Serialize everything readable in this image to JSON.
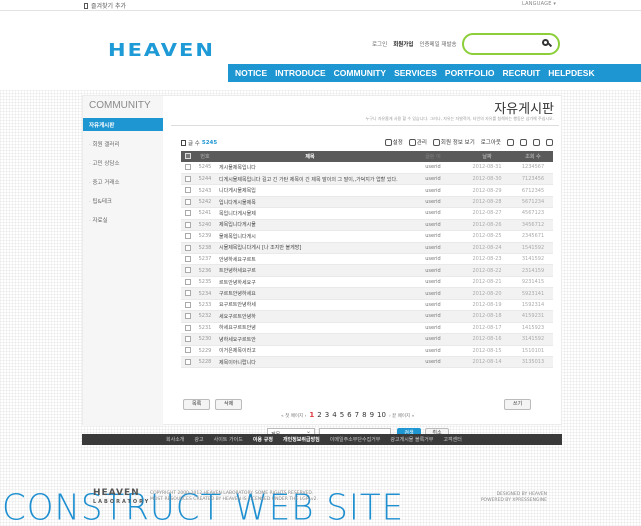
{
  "topbar": {
    "favorite": "즐겨찾기 추가",
    "language": "LANGUAGE ▾"
  },
  "header": {
    "logo": "HEAVEN",
    "member_links": [
      "로그인",
      "회원가입",
      "인증메일 재발송"
    ],
    "nav": [
      "NOTICE",
      "INTRODUCE",
      "COMMUNITY",
      "SERVICES",
      "PORTFOLIO",
      "RECRUIT",
      "HELPDESK"
    ]
  },
  "sidebar": {
    "title": "COMMUNITY",
    "active": "자유게시판",
    "items": [
      "회원 갤러리",
      "고민 상담소",
      "중고 거래소",
      "팁&테크",
      "자료실"
    ]
  },
  "board": {
    "title": "자유게시판",
    "description": "누구나 자유롭게 사용 할 수 있습니다. 그러나, 자유는 자발적이, 타인의 자유를 침해하는 행동은 삼가해 주십시오.",
    "count_label": "글 수",
    "count": "5245",
    "tools": [
      "설정",
      "관리",
      "회원 정보 보기",
      "로그아웃"
    ],
    "columns": [
      "번호",
      "제목",
      "글쓴 이",
      "날짜",
      "조회 수"
    ],
    "rows": [
      {
        "no": "5245",
        "title": "게시물제목입니다",
        "user": "userid",
        "date": "2012-08-31",
        "hits": "1234567"
      },
      {
        "no": "5244",
        "title": "디게시물제목입니다 길고 긴 가탄 제목이 긴 제목 말이의 그 말이,,가덕지가 업할 있다.",
        "user": "userid",
        "date": "2012-08-30",
        "hits": "7123456"
      },
      {
        "no": "5243",
        "title": "니다게시물제목입",
        "user": "userid",
        "date": "2012-08-29",
        "hits": "6712345"
      },
      {
        "no": "5242",
        "title": "입니다게시물제목",
        "user": "userid",
        "date": "2012-08-28",
        "hits": "5671234"
      },
      {
        "no": "5241",
        "title": "목입니다게시물제",
        "user": "userid",
        "date": "2012-08-27",
        "hits": "4567123"
      },
      {
        "no": "5240",
        "title": "제목입니다게시물",
        "user": "userid",
        "date": "2012-08-26",
        "hits": "3456712"
      },
      {
        "no": "5239",
        "title": "물제목입니다게시",
        "user": "userid",
        "date": "2012-08-25",
        "hits": "2345671"
      },
      {
        "no": "5238",
        "title": "시물제목입니다게시 [나 조지만 볼게방]",
        "user": "userid",
        "date": "2012-08-24",
        "hits": "1541592"
      },
      {
        "no": "5237",
        "title": "안녕하세요구르트",
        "user": "userid",
        "date": "2012-08-23",
        "hits": "3141592"
      },
      {
        "no": "5236",
        "title": "트안녕하세요구르",
        "user": "userid",
        "date": "2012-08-22",
        "hits": "2314159"
      },
      {
        "no": "5235",
        "title": "르트안녕하세요구",
        "user": "userid",
        "date": "2012-08-21",
        "hits": "9231415"
      },
      {
        "no": "5234",
        "title": "구르트안녕하세요",
        "user": "userid",
        "date": "2012-08-20",
        "hits": "5923141"
      },
      {
        "no": "5233",
        "title": "요구르트안녕하세",
        "user": "userid",
        "date": "2012-08-19",
        "hits": "1592314"
      },
      {
        "no": "5232",
        "title": "세요구르트안녕하",
        "user": "userid",
        "date": "2012-08-18",
        "hits": "4159231"
      },
      {
        "no": "5231",
        "title": "하세요구르트안녕",
        "user": "userid",
        "date": "2012-08-17",
        "hits": "1415923"
      },
      {
        "no": "5230",
        "title": "녕하세요구르트안",
        "user": "userid",
        "date": "2012-08-16",
        "hits": "3141592"
      },
      {
        "no": "5229",
        "title": "이거은제목이라고",
        "user": "userid",
        "date": "2012-08-15",
        "hits": "1510101"
      },
      {
        "no": "5228",
        "title": "제목이아니랍니다",
        "user": "userid",
        "date": "2012-08-14",
        "hits": "3135013"
      }
    ],
    "btn_list": "목록",
    "btn_delete": "삭제",
    "btn_write": "쓰기",
    "pager_prev": "« 첫 페이지 ‹",
    "pager_pages": [
      "1",
      "2",
      "3",
      "4",
      "5",
      "6",
      "7",
      "8",
      "9",
      "10"
    ],
    "pager_current": "1",
    "pager_next": "› 끝 페이지 »",
    "search_field": "제목",
    "search_button": "검색",
    "reset_button": "취소"
  },
  "footer": {
    "links": [
      "회사소개",
      "광고",
      "사이트 가이드",
      "이용 규정",
      "개인정보취급방침",
      "이메일주소무단수집거부",
      "광고게시물 블록거부",
      "고객센터"
    ],
    "highlight_links": [
      "이용 규정",
      "개인정보취급방침"
    ],
    "big_text": "CONSTRUCT WEB SITE",
    "logo_main": "HEAVEN",
    "logo_sub": "LABORATORY",
    "copyright_1": "COPYRIGHT 2000-2012 HEAVEN LABORATORY. SOME RIGHTS RESERVED.",
    "copyright_2": "MOST RESOURCES CREATED BY HEAVEN IS LICENSED UNDER THE LGPLv2.",
    "designed_by": "DESIGNED BY HEAVEN",
    "powered_by": "POWERED BY XPRESSENGINE"
  },
  "colors": {
    "accent": "#1e96d2",
    "search_border": "#8ccf3a",
    "current_page": "#e0353a"
  }
}
